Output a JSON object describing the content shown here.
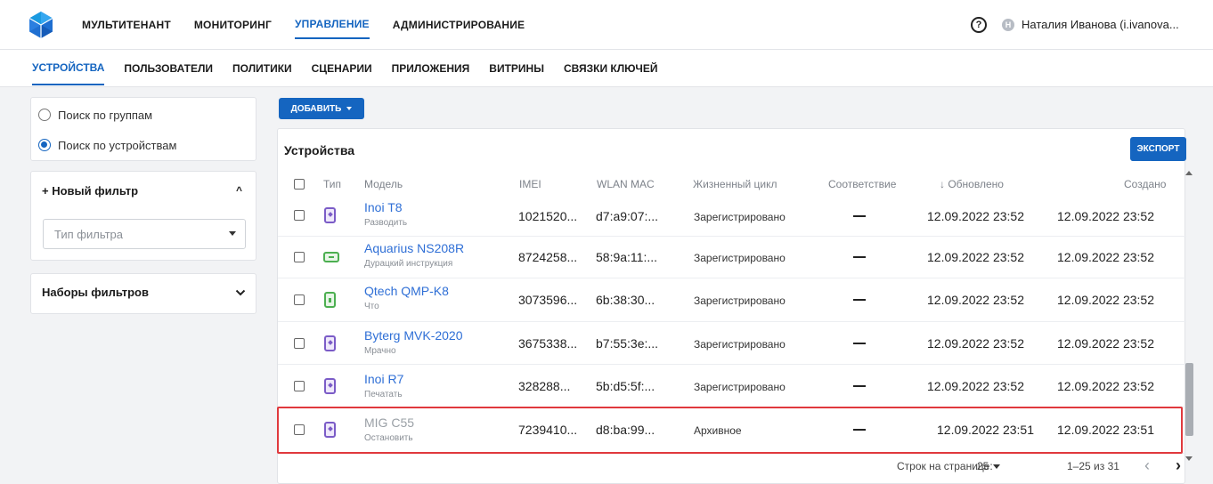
{
  "topnav": {
    "items": [
      "МУЛЬТИТЕНАНТ",
      "МОНИТОРИНГ",
      "УПРАВЛЕНИЕ",
      "АДМИНИСТРИРОВАНИЕ"
    ],
    "active_index": 2
  },
  "header": {
    "help_symbol": "?",
    "user_initial": "Н",
    "user_name": "Наталия Иванова (i.ivanova..."
  },
  "subnav": {
    "items": [
      "УСТРОЙСТВА",
      "ПОЛЬЗОВАТЕЛИ",
      "ПОЛИТИКИ",
      "СЦЕНАРИИ",
      "ПРИЛОЖЕНИЯ",
      "ВИТРИНЫ",
      "СВЯЗКИ КЛЮЧЕЙ"
    ],
    "active_index": 0
  },
  "search_mode": {
    "options": [
      "Поиск по группам",
      "Поиск по устройствам"
    ],
    "selected_index": 1
  },
  "filters": {
    "new_filter_label": "+ Новый фильтр",
    "filter_type_placeholder": "Тип фильтра",
    "filter_sets_label": "Наборы фильтров"
  },
  "toolbar": {
    "add_label": "ДОБАВИТЬ"
  },
  "table": {
    "title": "Устройства",
    "export_label": "ЭКСПОРТ",
    "columns": {
      "type": "Тип",
      "model": "Модель",
      "imei": "IMEI",
      "mac": "WLAN MAC",
      "lifecycle": "Жизненный цикл",
      "compliance": "Соответствие",
      "updated": "↓ Обновлено",
      "created": "Создано"
    },
    "rows": [
      {
        "type_icon": "phone-icon",
        "model": "Inoi T8",
        "subtitle": "Разводить",
        "imei": "1021520...",
        "mac": "d7:a9:07:...",
        "lifecycle": "Зарегистрировано",
        "updated": "12.09.2022 23:52",
        "created": "12.09.2022 23:52",
        "archived": false
      },
      {
        "type_icon": "tv-icon",
        "model": "Aquarius NS208R",
        "subtitle": "Дурацкий инструкция",
        "imei": "8724258...",
        "mac": "58:9a:11:...",
        "lifecycle": "Зарегистрировано",
        "updated": "12.09.2022 23:52",
        "created": "12.09.2022 23:52",
        "archived": false
      },
      {
        "type_icon": "tablet-icon",
        "model": "Qtech QMP-K8",
        "subtitle": "Что",
        "imei": "3073596...",
        "mac": "6b:38:30...",
        "lifecycle": "Зарегистрировано",
        "updated": "12.09.2022 23:52",
        "created": "12.09.2022 23:52",
        "archived": false
      },
      {
        "type_icon": "phone-icon",
        "model": "Byterg MVK-2020",
        "subtitle": "Мрачно",
        "imei": "3675338...",
        "mac": "b7:55:3e:...",
        "lifecycle": "Зарегистрировано",
        "updated": "12.09.2022 23:52",
        "created": "12.09.2022 23:52",
        "archived": false
      },
      {
        "type_icon": "phone-icon",
        "model": "Inoi R7",
        "subtitle": "Печатать",
        "imei": "328288...",
        "mac": "5b:d5:5f:...",
        "lifecycle": "Зарегистрировано",
        "updated": "12.09.2022 23:52",
        "created": "12.09.2022 23:52",
        "archived": false
      },
      {
        "type_icon": "phone-icon",
        "model": "MIG C55",
        "subtitle": "Остановить",
        "imei": "7239410...",
        "mac": "d8:ba:99...",
        "lifecycle": "Архивное",
        "updated": "12.09.2022 23:51",
        "created": "12.09.2022 23:51",
        "archived": true
      }
    ]
  },
  "pagination": {
    "rows_per_page_label": "Строк на странице:",
    "rows_per_page": "25",
    "range": "1–25 из 31",
    "prev": "‹",
    "next": "›"
  },
  "colors": {
    "accent": "#1565c0",
    "link": "#2f6fd6",
    "highlight": "#e0393d"
  }
}
